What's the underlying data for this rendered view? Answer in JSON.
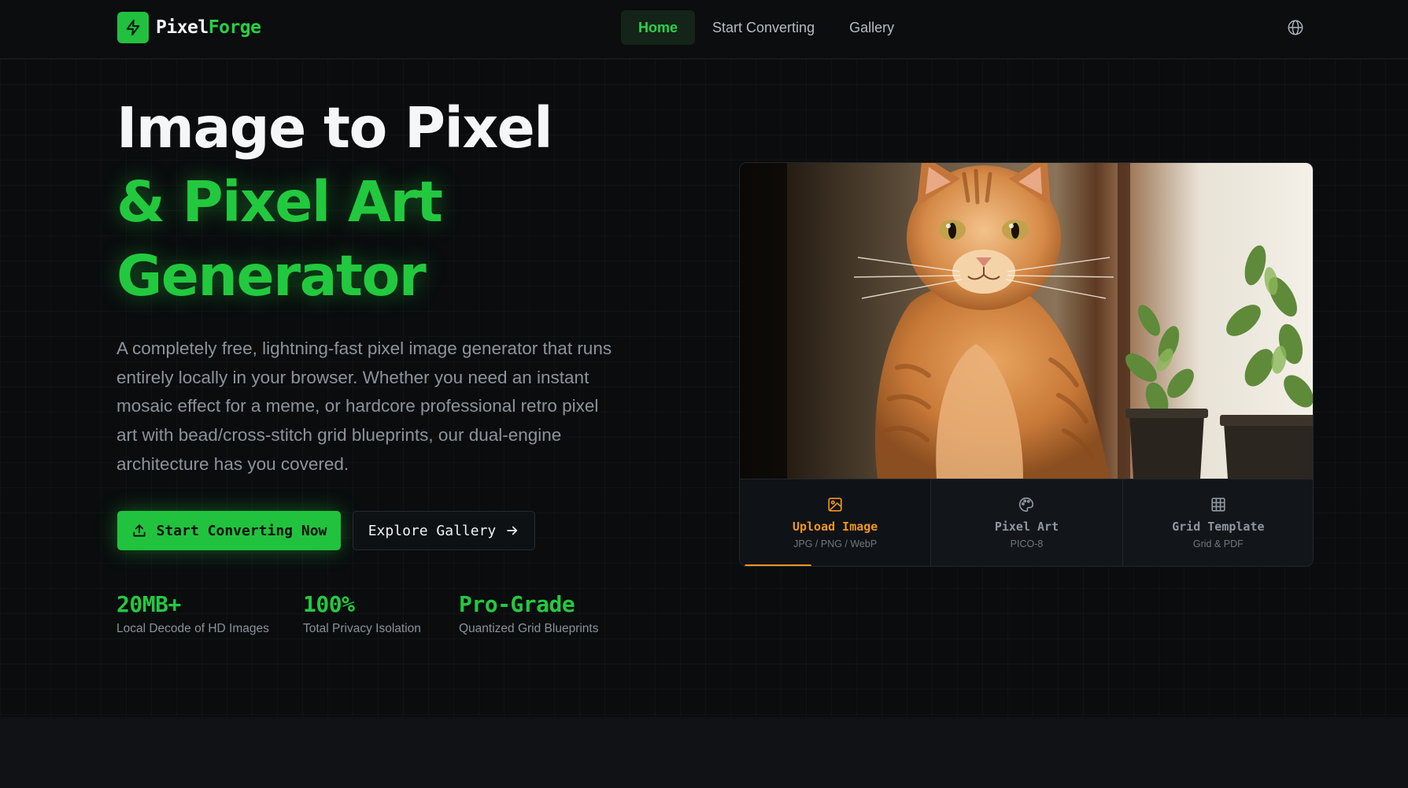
{
  "brand": {
    "name_part1": "Pixel",
    "name_part2": "Forge",
    "accent": "#22c03f"
  },
  "nav": {
    "links": [
      {
        "label": "Home",
        "active": true
      },
      {
        "label": "Start Converting",
        "active": false
      },
      {
        "label": "Gallery",
        "active": false
      }
    ],
    "language_icon": "globe-icon"
  },
  "hero": {
    "title_line1": "Image to Pixel",
    "title_line2": "& Pixel Art",
    "title_line3": "Generator",
    "description": "A completely free, lightning-fast pixel image generator that runs entirely locally in your browser. Whether you need an instant mosaic effect for a meme, or hardcore professional retro pixel art with bead/cross-stitch grid blueprints, our dual-engine architecture has you covered.",
    "primary_button": "Start Converting Now",
    "secondary_button": "Explore Gallery"
  },
  "stats": [
    {
      "value": "20MB+",
      "label": "Local Decode of HD Images"
    },
    {
      "value": "100%",
      "label": "Total Privacy Isolation"
    },
    {
      "value": "Pro-Grade",
      "label": "Quantized Grid Blueprints"
    }
  ],
  "showcase": {
    "image_subject": "orange tabby cat by window with plants",
    "steps": [
      {
        "title": "Upload Image",
        "subtitle": "JPG / PNG / WebP",
        "icon": "image-icon",
        "active": true
      },
      {
        "title": "Pixel Art",
        "subtitle": "PICO-8",
        "icon": "palette-icon",
        "active": false
      },
      {
        "title": "Grid Template",
        "subtitle": "Grid & PDF",
        "icon": "grid-icon",
        "active": false
      }
    ],
    "progress": 0.12,
    "active_color": "#f0961e"
  }
}
